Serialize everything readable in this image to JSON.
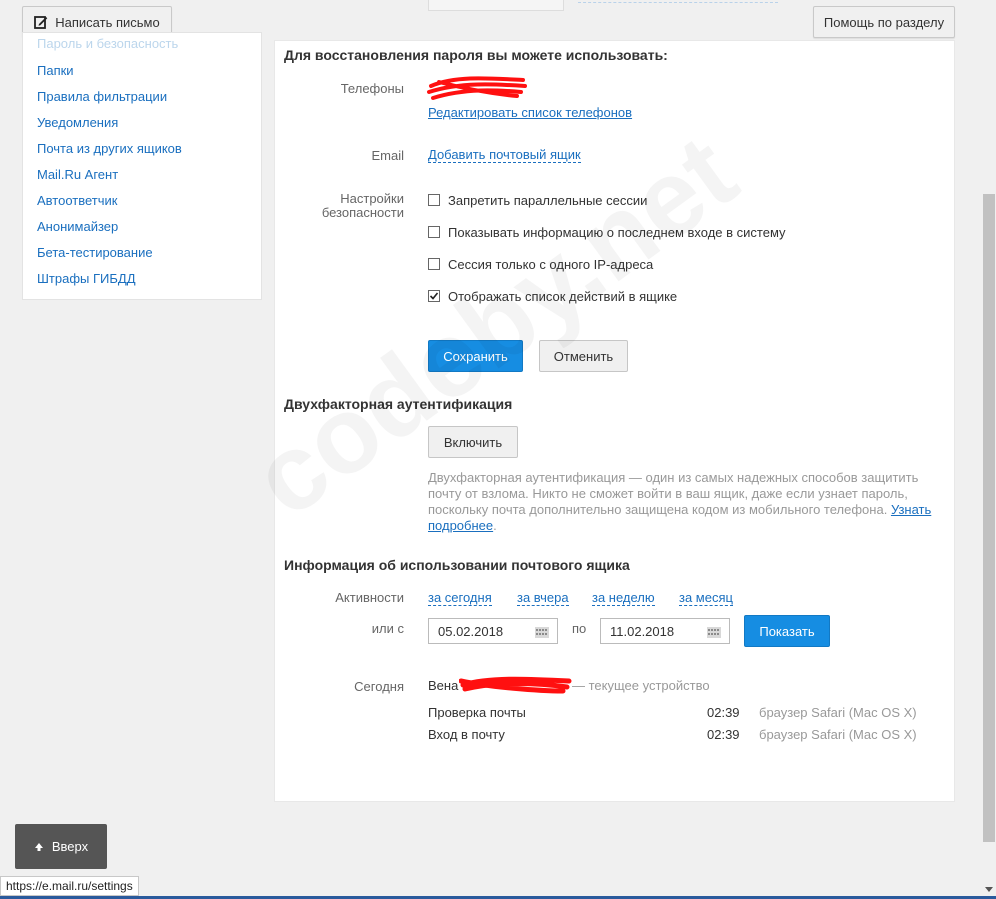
{
  "toolbar": {
    "compose_label": "Написать письмо",
    "help_label": "Помощь по разделу"
  },
  "sidebar": {
    "clipped_item": "Пароль и безопасность",
    "items": [
      {
        "label": "Папки"
      },
      {
        "label": "Правила фильтрации"
      },
      {
        "label": "Уведомления"
      },
      {
        "label": "Почта из других ящиков"
      },
      {
        "label": "Mail.Ru Агент"
      },
      {
        "label": "Автоответчик"
      },
      {
        "label": "Анонимайзер"
      },
      {
        "label": "Бета-тестирование"
      },
      {
        "label": "Штрафы ГИБДД"
      }
    ]
  },
  "recovery": {
    "title": "Для восстановления пароля вы можете использовать:",
    "phones_label": "Телефоны",
    "edit_phones_link": "Редактировать список телефонов",
    "email_label": "Email",
    "add_mailbox_link": "Добавить почтовый ящик",
    "security_label_1": "Настройки",
    "security_label_2": "безопасности",
    "options": [
      {
        "label": "Запретить параллельные сессии",
        "checked": false
      },
      {
        "label": "Показывать информацию о последнем входе в систему",
        "checked": false
      },
      {
        "label": "Сессия только с одного IP-адреса",
        "checked": false
      },
      {
        "label": "Отображать список действий в ящике",
        "checked": true
      }
    ],
    "save_label": "Сохранить",
    "cancel_label": "Отменить"
  },
  "twofactor": {
    "title": "Двухфакторная аутентификация",
    "enable_label": "Включить",
    "description": "Двухфакторная аутентификация — один из самых надежных способов защитить почту от взлома. Никто не сможет войти в ваш ящик, даже если узнает пароль, поскольку почта дополнительно защищена кодом из мобильного телефона.",
    "learn_more": "Узнать подробнее"
  },
  "usage": {
    "title": "Информация об использовании почтового ящика",
    "activity_label": "Активности",
    "periods": [
      {
        "label": "за сегодня"
      },
      {
        "label": "за вчера"
      },
      {
        "label": "за неделю"
      },
      {
        "label": "за месяц"
      }
    ],
    "or_from_label": "или с",
    "date_from": "05.02.2018",
    "to_label": "по",
    "date_to": "11.02.2018",
    "show_label": "Показать",
    "today_label": "Сегодня",
    "location": "Вена",
    "current_device": "— текущее устройство",
    "rows": [
      {
        "action": "Проверка почты",
        "time": "02:39",
        "client": "браузер Safari (Mac OS X)"
      },
      {
        "action": "Вход в почту",
        "time": "02:39",
        "client": "браузер Safari (Mac OS X)"
      }
    ]
  },
  "up_label": "Вверх",
  "status_url": "https://e.mail.ru/settings",
  "watermark": "codeby.net",
  "colors": {
    "accent": "#168de2",
    "link": "#1a6fbf",
    "redaction": "#ff0000"
  }
}
